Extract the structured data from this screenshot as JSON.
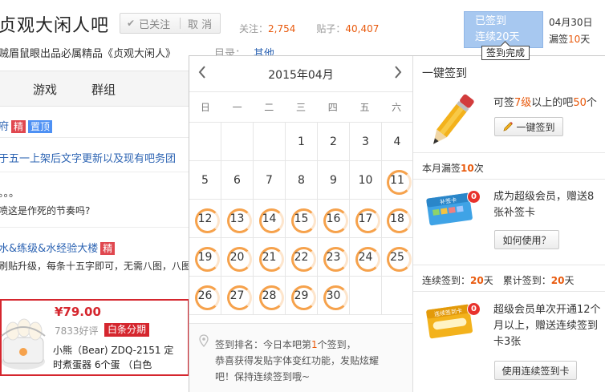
{
  "header": {
    "forum_name": "贞观大闲人吧",
    "follow_label": "已关注",
    "cancel_label": "取 消",
    "follow_count_label": "关注：",
    "follow_count": "2,754",
    "post_count_label": "贴子：",
    "post_count": "40,407",
    "slogan": "贼眉鼠眼出品必属精品《贞观大闲人》",
    "catalog_label": "目录：",
    "catalog_value": "其他"
  },
  "signin": {
    "button_line1": "已签到",
    "button_line2": "连续20天",
    "date": "04月30日",
    "missed_prefix": "漏签",
    "missed_count": "10",
    "missed_suffix": "天",
    "tooltip": "签到完成"
  },
  "nav": {
    "items": [
      "游戏",
      "群组"
    ]
  },
  "threads": [
    {
      "text": "府",
      "badges": [
        "精",
        "置顶"
      ]
    },
    {
      "text": "于五一上架后文字更新以及现有吧务团"
    },
    {
      "text": "。。。"
    },
    {
      "text": "喷这是作死的节奏吗?"
    },
    {
      "text": "水&练级&水经验大楼",
      "badges": [
        "精"
      ]
    },
    {
      "text": "刷贴升级，每条十五字即可，无需八图，八图"
    }
  ],
  "ad": {
    "price": "¥79.00",
    "good": "7833好评",
    "installment": "白条分期",
    "product_line1": "小熊（Bear) ZDQ-2151 定",
    "product_line2": "时煮蛋器 6个蛋 （白色"
  },
  "calendar": {
    "title": "2015年04月",
    "prev_icon": "chevron-left-icon",
    "next_icon": "chevron-right-icon",
    "weekdays": [
      "日",
      "一",
      "二",
      "三",
      "四",
      "五",
      "六"
    ],
    "first_weekday": 3,
    "days_in_month": 30,
    "signed_days": [
      11,
      12,
      13,
      14,
      15,
      16,
      17,
      18,
      19,
      20,
      21,
      22,
      23,
      24,
      25,
      26,
      27,
      28,
      29,
      30
    ],
    "signed_color": "#f6a24c",
    "rank_line1_a": "签到排名：今日本吧第",
    "rank_num": "1",
    "rank_line1_b": "个签到，",
    "rank_line2": "恭喜获得发贴字体变红功能，发贴炫耀",
    "rank_line3": "吧！保持连续签到哦~"
  },
  "right_panel": {
    "one_key_title": "一键签到",
    "one_key_text_a": "可签",
    "one_key_level": "7级",
    "one_key_text_b": "以上的吧",
    "one_key_count": "50",
    "one_key_text_c": "个",
    "one_key_button": "一键签到",
    "missed_a": "本月漏签",
    "missed_num": "10",
    "missed_b": "次",
    "card_badge": "0",
    "card_text": "成为超级会员，赠送8张补签卡",
    "how_button": "如何使用？",
    "cont_a": "连续签到：",
    "cont_num": "20",
    "cont_b": "天",
    "total_a": "累计签到：",
    "total_num": "20",
    "total_b": "天",
    "card2_badge": "0",
    "card2_text": "超级会员单次开通12个月以上，赠送连续签到卡3张",
    "use_card_button": "使用连续签到卡",
    "accent": "#e8590c"
  }
}
